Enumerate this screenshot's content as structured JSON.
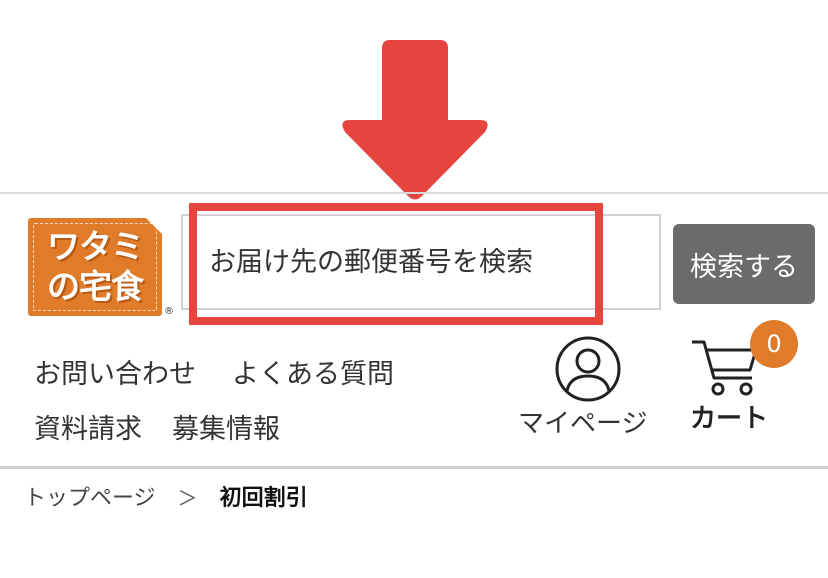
{
  "logo": {
    "line1": "ワタミ",
    "line2": "の宅食",
    "registered": "®"
  },
  "search": {
    "placeholder": "お届け先の郵便番号を検索",
    "button_label": "検索する"
  },
  "nav": {
    "contact": "お問い合わせ",
    "faq": "よくある質問",
    "brochure": "資料請求",
    "recruit": "募集情報"
  },
  "mypage": {
    "label": "マイページ"
  },
  "cart": {
    "label": "カート",
    "count": "0"
  },
  "breadcrumb": {
    "home": "トップページ",
    "separator": "＞",
    "current": "初回割引"
  },
  "colors": {
    "arrow": "#e5453e",
    "highlight": "#e5453e",
    "brand": "#e07b2a",
    "button": "#6b6b6b"
  }
}
